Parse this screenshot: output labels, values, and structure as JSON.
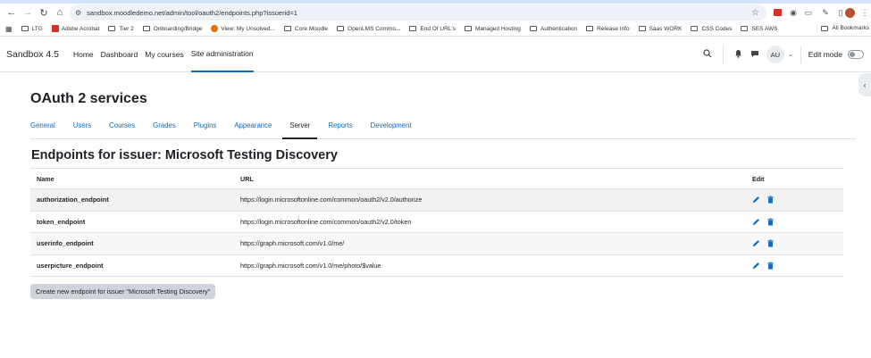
{
  "browser": {
    "url": "sandbox.moodledemo.net/admin/tool/oauth2/endpoints.php?issuerid=1",
    "bookmarks": [
      "LTG",
      "Adobe Acrobat",
      "Tier 2",
      "Onboarding/Bridge",
      "View: My Unsolved...",
      "Core Moodle",
      "OpenLMS Commo...",
      "End Of URL's",
      "Managed Hosting",
      "Authentication",
      "Release Info",
      "Saas WORK",
      "CSS Codes",
      "SES AWS"
    ],
    "all_bookmarks": "All Bookmarks"
  },
  "navbar": {
    "brand": "Sandbox 4.5",
    "items": [
      "Home",
      "Dashboard",
      "My courses",
      "Site administration"
    ],
    "avatar": "AU",
    "edit_mode": "Edit mode"
  },
  "page": {
    "title": "OAuth 2 services",
    "tabs": [
      "General",
      "Users",
      "Courses",
      "Grades",
      "Plugins",
      "Appearance",
      "Server",
      "Reports",
      "Development"
    ],
    "active_tab": "Server",
    "section_title": "Endpoints for issuer: Microsoft Testing Discovery",
    "columns": [
      "Name",
      "URL",
      "Edit"
    ],
    "rows": [
      {
        "name": "authorization_endpoint",
        "url": "https://login.microsoftonline.com/common/oauth2/v2.0/authorize"
      },
      {
        "name": "token_endpoint",
        "url": "https://login.microsoftonline.com/common/oauth2/v2.0/token"
      },
      {
        "name": "userinfo_endpoint",
        "url": "https://graph.microsoft.com/v1.0/me/"
      },
      {
        "name": "userpicture_endpoint",
        "url": "https://graph.microsoft.com/v1.0/me/photo/$value"
      }
    ],
    "create_button": "Create new endpoint for issuer \"Microsoft Testing Discovery\""
  },
  "colors": {
    "link": "#0f6cbf",
    "active_border": "#0f6cbf",
    "alt_row": "#f2f2f2",
    "button_bg": "#ced4da"
  },
  "icons": [
    "back-icon",
    "forward-icon",
    "reload-icon",
    "home-icon",
    "site-info-icon",
    "star-icon",
    "apps-icon",
    "folder-icon",
    "search-icon",
    "bell-icon",
    "chat-icon",
    "pencil-icon",
    "trash-icon"
  ]
}
